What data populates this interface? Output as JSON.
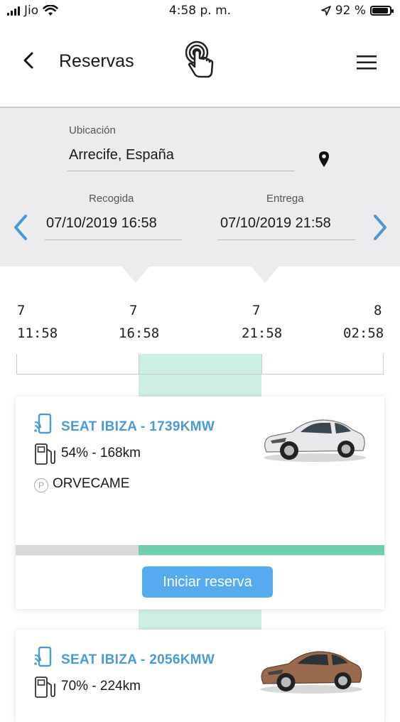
{
  "status_bar": {
    "carrier": "Jio",
    "time": "4:58 p. m.",
    "battery_pct_text": "92 %",
    "battery_level": 0.92
  },
  "header": {
    "title": "Reservas"
  },
  "filters": {
    "location_label": "Ubicación",
    "location_value": "Arrecife, España",
    "pickup_label": "Recogida",
    "pickup_value": "07/10/2019 16:58",
    "return_label": "Entrega",
    "return_value": "07/10/2019 21:58"
  },
  "timeline": {
    "ticks": [
      {
        "day": "7",
        "time": "11:58"
      },
      {
        "day": "7",
        "time": "16:58"
      },
      {
        "day": "7",
        "time": "21:58"
      },
      {
        "day": "8",
        "time": "02:58"
      }
    ]
  },
  "cars": [
    {
      "name": "SEAT IBIZA - 1739KMW",
      "fuel": "54% - 168km",
      "parking": "ORVECAME",
      "parking_badge": "P",
      "color": "#e8e8ea",
      "button_label": "Iniciar reserva"
    },
    {
      "name": "SEAT IBIZA - 2056KMW",
      "fuel": "70% - 224km",
      "color": "#9a6a4e"
    }
  ],
  "colors": {
    "accent": "#4a9ad6",
    "timeline_band": "#cdeee2",
    "progress": "#6fcfac",
    "button": "#56aaf0"
  }
}
